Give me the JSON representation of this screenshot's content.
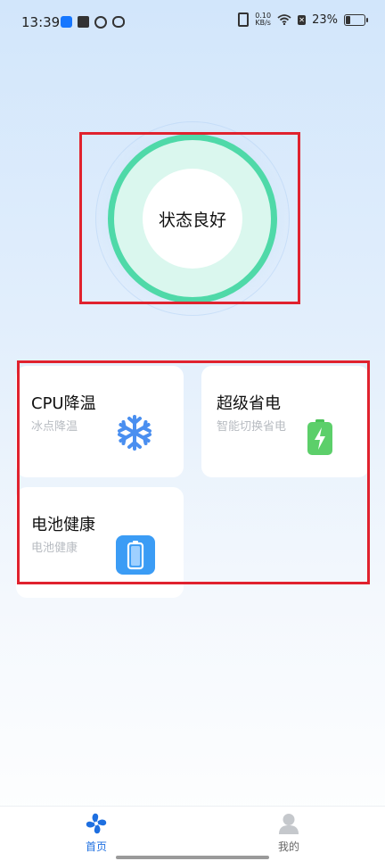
{
  "status_bar": {
    "time": "13:39",
    "net_speed_value": "0.10",
    "net_speed_unit": "KB/s",
    "sim_label": "✕",
    "battery": "23%",
    "battery_level": 0.23
  },
  "status_circle": {
    "text": "状态良好",
    "ring_color": "#4fd9a8"
  },
  "cards": {
    "cpu": {
      "title": "CPU降温",
      "subtitle": "冰点降温",
      "icon": "snowflake-icon"
    },
    "saver": {
      "title": "超级省电",
      "subtitle": "智能切换省电",
      "icon": "battery-charging-icon"
    },
    "health": {
      "title": "电池健康",
      "subtitle": "电池健康",
      "icon": "battery-icon"
    }
  },
  "bottom_nav": {
    "items": [
      {
        "label": "首页",
        "icon": "fan-icon",
        "active": true
      },
      {
        "label": "我的",
        "icon": "user-icon",
        "active": false
      }
    ]
  },
  "colors": {
    "accent": "#1e6fe0",
    "highlight": "#e0222e",
    "saver_green": "#4cc35a",
    "health_blue": "#3b9cf5",
    "snow_blue": "#4a8ff0"
  }
}
